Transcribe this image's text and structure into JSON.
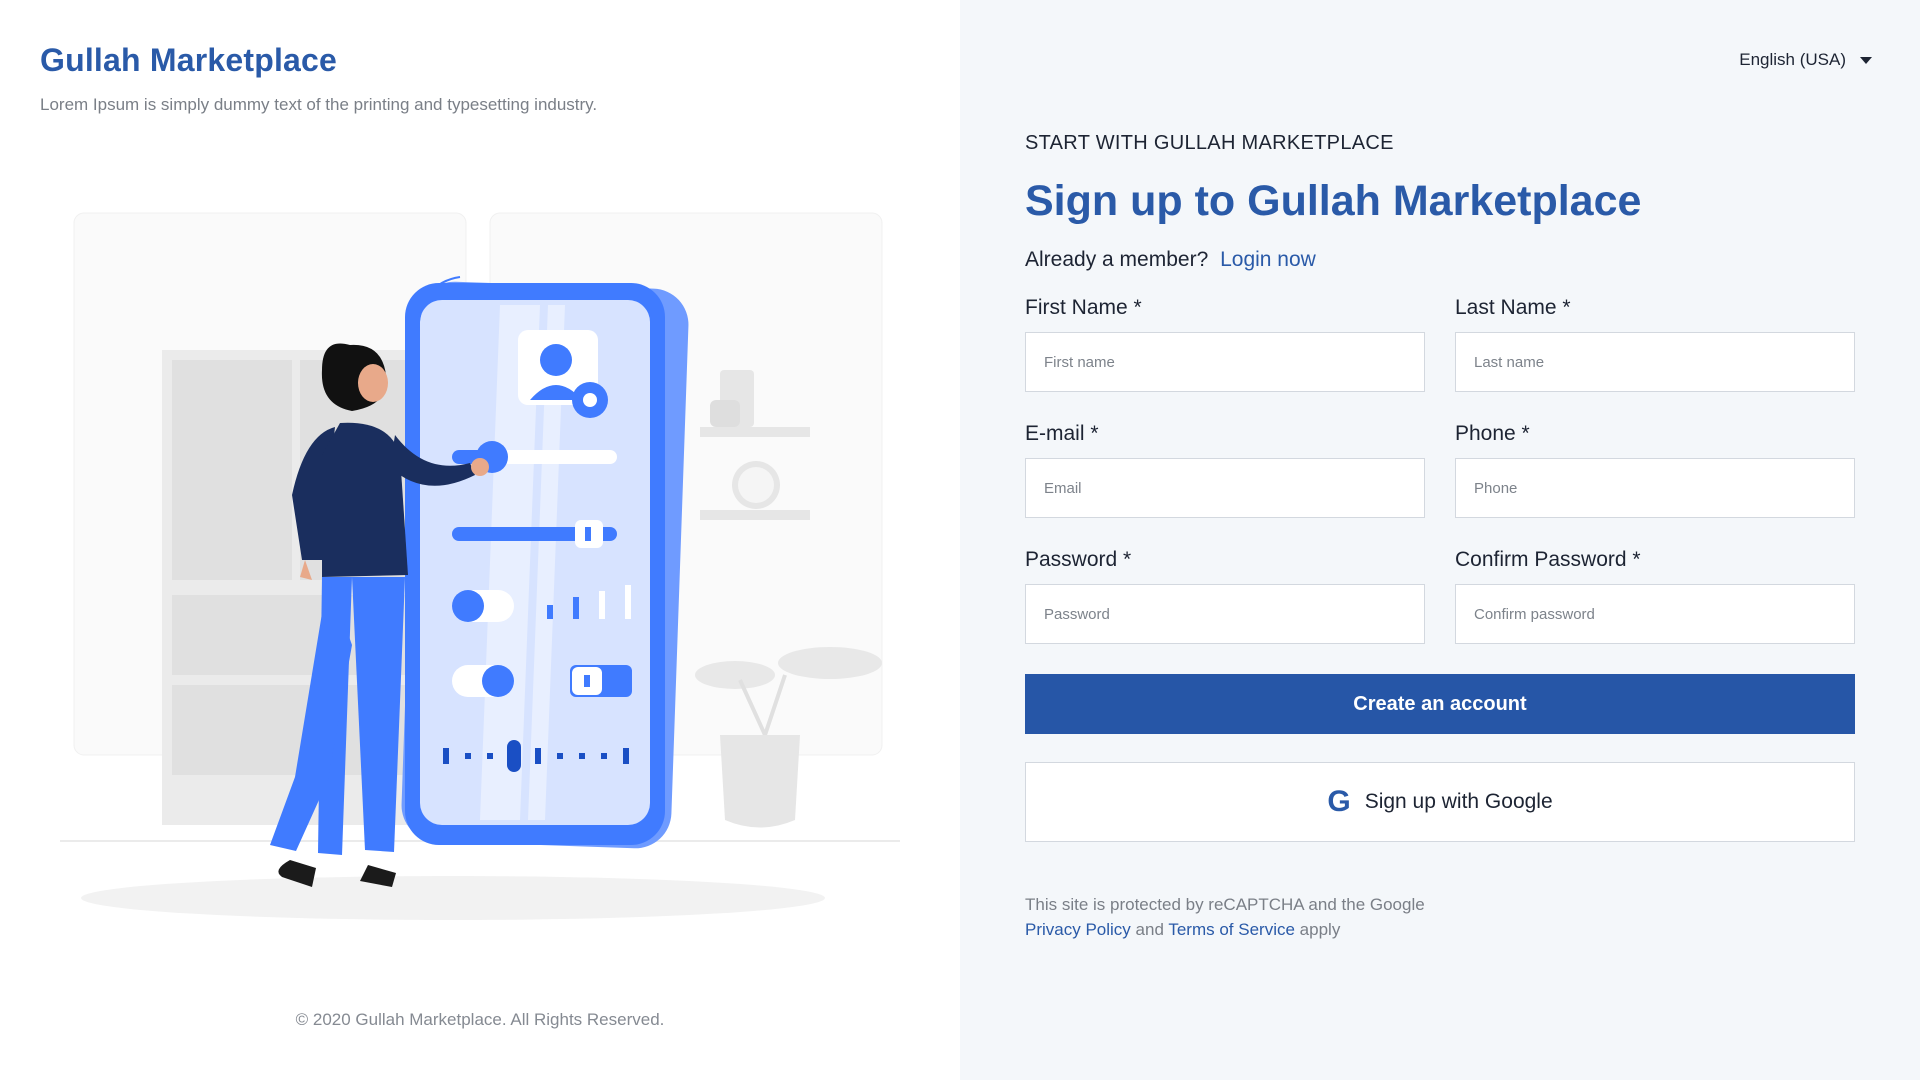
{
  "brand": {
    "name": "Gullah Marketplace",
    "tagline": "Lorem Ipsum is simply dummy text of the printing and typesetting industry."
  },
  "footer": {
    "copyright": "© 2020 Gullah Marketplace. All Rights Reserved."
  },
  "language": {
    "selected": "English (USA)"
  },
  "signup": {
    "eyebrow": "START WITH GULLAH MARKETPLACE",
    "title": "Sign up to Gullah Marketplace",
    "member_text": "Already a member?",
    "login_link": "Login now",
    "fields": {
      "first_name": {
        "label": "First Name *",
        "placeholder": "First name"
      },
      "last_name": {
        "label": "Last Name *",
        "placeholder": "Last name"
      },
      "email": {
        "label": "E-mail *",
        "placeholder": "Email"
      },
      "phone": {
        "label": "Phone *",
        "placeholder": "Phone"
      },
      "password": {
        "label": "Password *",
        "placeholder": "Password"
      },
      "confirm_password": {
        "label": "Confirm Password *",
        "placeholder": "Confirm password"
      }
    },
    "create_button": "Create an account",
    "google_button": "Sign up with Google",
    "google_icon": "G",
    "recaptcha": {
      "line1": "This site is protected by reCAPTCHA and the Google",
      "privacy": "Privacy Policy",
      "and": "and",
      "terms": "Terms of Service",
      "apply": "apply"
    }
  },
  "colors": {
    "brand_blue": "#2a5aa8",
    "button_blue": "#2656a7",
    "right_panel_bg": "#f4f7fa",
    "illustration_blue": "#407bff",
    "illustration_navy": "#1a2e5e"
  }
}
